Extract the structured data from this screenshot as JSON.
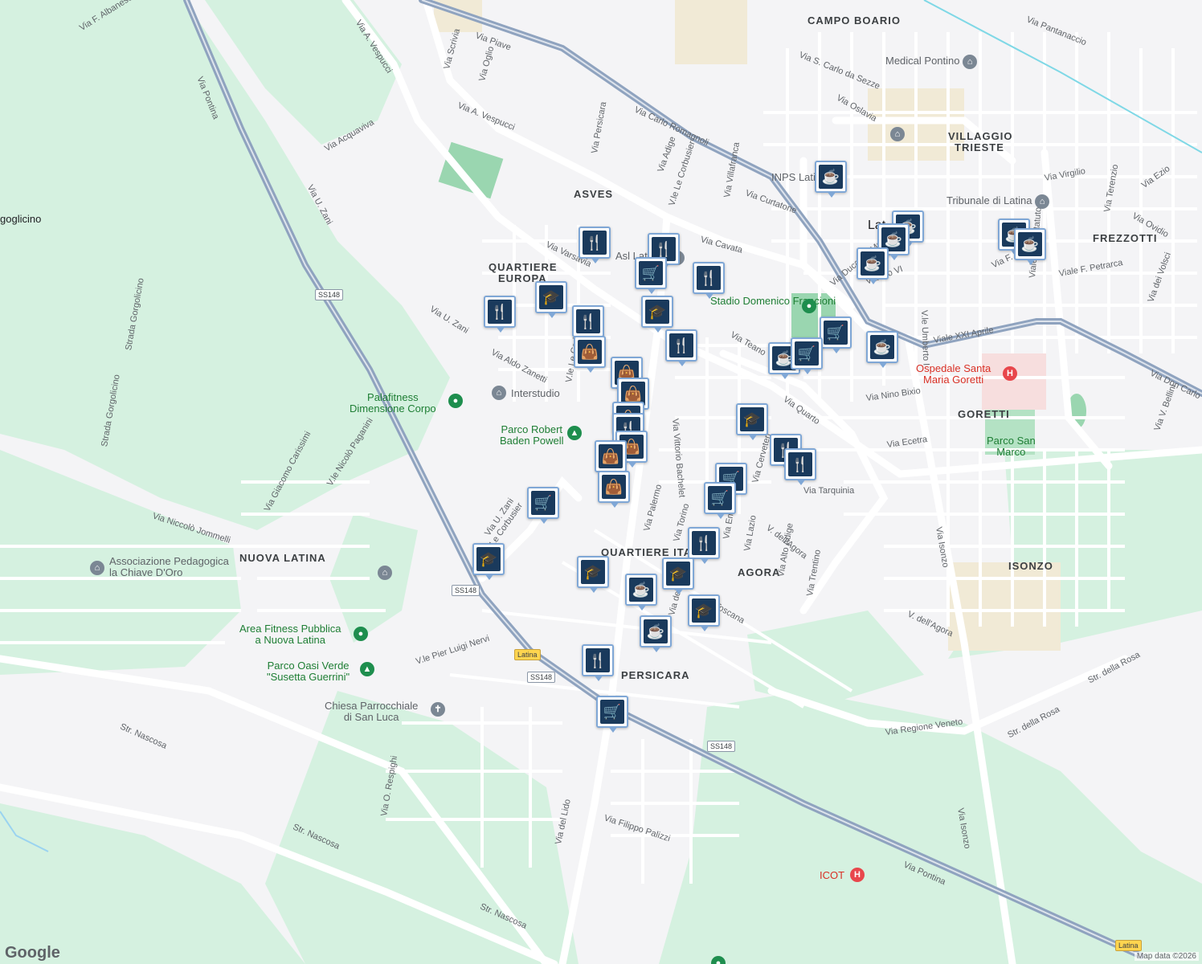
{
  "map": {
    "attribution": "Map data ©2026",
    "logo": "Google",
    "colors": {
      "land": "#f4f4f6",
      "park": "#cfeedd",
      "major_road": "#8fa3bf",
      "road": "#ffffff",
      "pin": "#1a3a5c"
    }
  },
  "areas": [
    "CAMPO BOARIO",
    "VILLAGGIO",
    "TRIESTE",
    "ASVES",
    "QUARTIERE",
    "EUROPA",
    "FREZZOTTI",
    "GORETTI",
    "NUOVA LATINA",
    "QUARTIERE ITA",
    "AGORA",
    "ISONZO",
    "PERSICARA"
  ],
  "streets": [
    "Via F. Albanese",
    "Via Pontina",
    "Via U. Zani",
    "Via Acquaviva",
    "Via A. Vespucci",
    "Via Piave",
    "Via Carlo Romagnoli",
    "Via Scrivia",
    "Via Oglio",
    "Via Persicara",
    "Via Adige",
    "V.le Le Corbusier",
    "Via Varsavia",
    "Via Aldo Zanetti",
    "Via Cavata",
    "Via Villafranca",
    "Via Curtatone",
    "Via S. Carlo da Sezze",
    "Via Oslavia",
    "Via Pantanaccio",
    "Via Virgilio",
    "Via Ezio",
    "Via Terenzio",
    "Via Ovidio",
    "Viale F. Petrarca",
    "Via F. Filzi",
    "Viale dello Statuto",
    "Viale XXI Aprile",
    "Via Don Carlo",
    "Via dei Volsci",
    "Via V. Bellini",
    "Via Teano",
    "Via Quarto",
    "Via Nino Bixio",
    "Via Ecetra",
    "Via Tarquinia",
    "Via Cerveteri",
    "V. dell'Agora",
    "Via Vittorio Bachelet",
    "Via Palermo",
    "Via Torino",
    "Via Emilia",
    "Via Lazio",
    "Via Alto Adige",
    "Via Trentino",
    "Via Toscana",
    "Via del Lido",
    "Via Isonzo",
    "Via Pontina",
    "Via Regione Veneto",
    "Str. della Rosa",
    "Str. Nascosa",
    "Via O. Respighi",
    "Via Filippo Palizzi",
    "V.le Pier Luigi Nervi",
    "Via Niccolò Jommelli",
    "Via Giacomo Carissimi",
    "V.le Nicolò Paganini",
    "Strada Gorgolicino",
    "Via Pio VI",
    "V.le Umberto I",
    "Via Duca del Mare"
  ],
  "places": {
    "medical_pontino": "Medical Pontino",
    "inps": "INPS Latina",
    "tribunale": "Tribunale di Latina",
    "asl": "Asl Latina",
    "stadio": "Stadio Domenico Francioni",
    "ospedale_1": "Ospedale Santa",
    "ospedale_2": "Maria Goretti",
    "parco_san_marco_1": "Parco San",
    "parco_san_marco_2": "Marco",
    "interstudio": "Interstudio",
    "palafitness_1": "Palafitness",
    "palafitness_2": "Dimensione Corpo",
    "parco_robert_1": "Parco Robert",
    "parco_robert_2": "Baden Powell",
    "associazione_1": "Associazione Pedagogica",
    "associazione_2": "la Chiave D'Oro",
    "area_fitness_1": "Area Fitness Pubblica",
    "area_fitness_2": "a Nuova Latina",
    "parco_oasi_1": "Parco Oasi Verde",
    "parco_oasi_2": "\"Susetta Guerrini\"",
    "chiesa_1": "Chiesa Parrocchiale",
    "chiesa_2": "di San Luca",
    "icot": "ICOT",
    "gorgolicino": "goglicino",
    "latina": "Lat"
  },
  "shields": [
    "SS148",
    "SS148",
    "SS148",
    "SS148",
    "Latina",
    "Latina"
  ],
  "icons": {
    "cafe": "cafe-icon",
    "restaurant": "restaurant-icon",
    "grocery": "grocery-cart-icon",
    "shopping": "shopping-bag-icon",
    "school": "school-icon",
    "hospital": "hospital-icon",
    "park": "park-icon"
  }
}
